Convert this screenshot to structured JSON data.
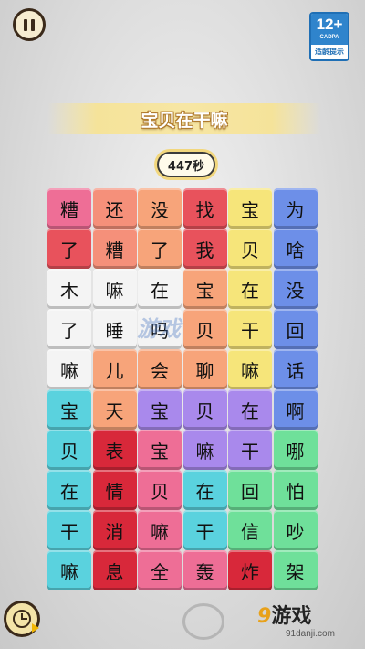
{
  "header": {
    "pause_icon": "pause-icon",
    "age_rating": {
      "number": "12+",
      "org": "CADPA",
      "label": "适龄提示"
    }
  },
  "level": {
    "title": "宝贝在干嘛"
  },
  "timer": {
    "text": "447秒"
  },
  "colors": {
    "red": "#e8525c",
    "salmon": "#f5907a",
    "orange": "#f7a47a",
    "yellow": "#f6e57a",
    "blue": "#6d8fe8",
    "white": "#f4f4f4",
    "cyan": "#5ad2de",
    "darkred": "#d8283a",
    "purple": "#a989ec",
    "green": "#6fe09a",
    "pink": "#ee6e96"
  },
  "board": {
    "rows": [
      [
        {
          "t": "糟",
          "c": "pink"
        },
        {
          "t": "还",
          "c": "salmon"
        },
        {
          "t": "没",
          "c": "orange"
        },
        {
          "t": "找",
          "c": "red"
        },
        {
          "t": "宝",
          "c": "yellow"
        },
        {
          "t": "为",
          "c": "blue"
        }
      ],
      [
        {
          "t": "了",
          "c": "red"
        },
        {
          "t": "糟",
          "c": "salmon"
        },
        {
          "t": "了",
          "c": "orange"
        },
        {
          "t": "我",
          "c": "red"
        },
        {
          "t": "贝",
          "c": "yellow"
        },
        {
          "t": "啥",
          "c": "blue"
        }
      ],
      [
        {
          "t": "木",
          "c": "white"
        },
        {
          "t": "嘛",
          "c": "white"
        },
        {
          "t": "在",
          "c": "white"
        },
        {
          "t": "宝",
          "c": "orange"
        },
        {
          "t": "在",
          "c": "yellow"
        },
        {
          "t": "没",
          "c": "blue"
        }
      ],
      [
        {
          "t": "了",
          "c": "white"
        },
        {
          "t": "睡",
          "c": "white"
        },
        {
          "t": "吗",
          "c": "white"
        },
        {
          "t": "贝",
          "c": "orange"
        },
        {
          "t": "干",
          "c": "yellow"
        },
        {
          "t": "回",
          "c": "blue"
        }
      ],
      [
        {
          "t": "嘛",
          "c": "white"
        },
        {
          "t": "儿",
          "c": "orange"
        },
        {
          "t": "会",
          "c": "orange"
        },
        {
          "t": "聊",
          "c": "orange"
        },
        {
          "t": "嘛",
          "c": "yellow"
        },
        {
          "t": "话",
          "c": "blue"
        }
      ],
      [
        {
          "t": "宝",
          "c": "cyan"
        },
        {
          "t": "天",
          "c": "orange"
        },
        {
          "t": "宝",
          "c": "purple"
        },
        {
          "t": "贝",
          "c": "purple"
        },
        {
          "t": "在",
          "c": "purple"
        },
        {
          "t": "啊",
          "c": "blue"
        }
      ],
      [
        {
          "t": "贝",
          "c": "cyan"
        },
        {
          "t": "表",
          "c": "darkred"
        },
        {
          "t": "宝",
          "c": "pink"
        },
        {
          "t": "嘛",
          "c": "purple"
        },
        {
          "t": "干",
          "c": "purple"
        },
        {
          "t": "哪",
          "c": "green"
        }
      ],
      [
        {
          "t": "在",
          "c": "cyan"
        },
        {
          "t": "情",
          "c": "darkred"
        },
        {
          "t": "贝",
          "c": "pink"
        },
        {
          "t": "在",
          "c": "cyan"
        },
        {
          "t": "回",
          "c": "green"
        },
        {
          "t": "怕",
          "c": "green"
        }
      ],
      [
        {
          "t": "干",
          "c": "cyan"
        },
        {
          "t": "消",
          "c": "darkred"
        },
        {
          "t": "嘛",
          "c": "pink"
        },
        {
          "t": "干",
          "c": "cyan"
        },
        {
          "t": "信",
          "c": "green"
        },
        {
          "t": "吵",
          "c": "green"
        }
      ],
      [
        {
          "t": "嘛",
          "c": "cyan"
        },
        {
          "t": "息",
          "c": "darkred"
        },
        {
          "t": "全",
          "c": "pink"
        },
        {
          "t": "轰",
          "c": "pink"
        },
        {
          "t": "炸",
          "c": "darkred"
        },
        {
          "t": "架",
          "c": "green"
        }
      ]
    ]
  },
  "watermark": {
    "text": "游戏"
  },
  "footer": {
    "hint_icon": "clock-hint-icon",
    "site_name_num": "9",
    "site_name_text": "游戏",
    "site_url": "91danji.com"
  }
}
